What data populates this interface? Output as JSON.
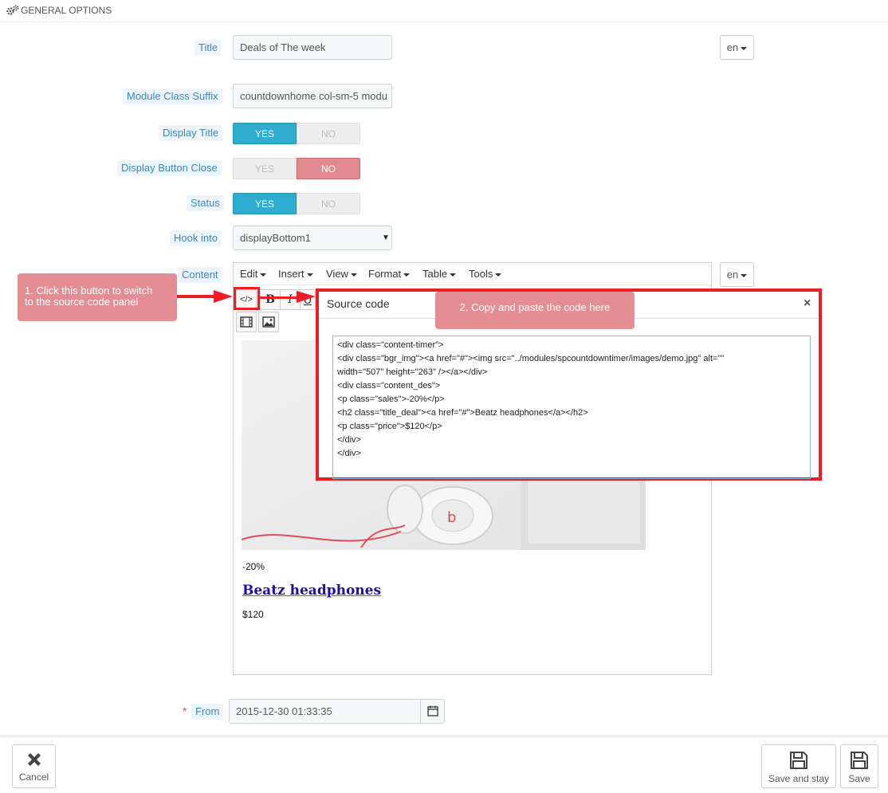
{
  "header": {
    "title": "GENERAL OPTIONS",
    "icon": "gears-icon"
  },
  "form": {
    "title_label": "Title",
    "title_value": "Deals of The week",
    "title_lang": "en",
    "suffix_label": "Module Class Suffix",
    "suffix_value": "countdownhome col-sm-5 modu",
    "display_title_label": "Display Title",
    "display_title_value": "YES",
    "display_close_label": "Display Button Close",
    "display_close_value": "NO",
    "status_label": "Status",
    "status_value": "YES",
    "yes": "YES",
    "no": "NO",
    "hook_label": "Hook into",
    "hook_value": "displayBottom1",
    "content_label": "Content",
    "content_lang": "en",
    "from_label": "From",
    "from_required": "*",
    "from_value": "2015-12-30 01:33:35"
  },
  "editor": {
    "menu": [
      "Edit",
      "Insert",
      "View",
      "Format",
      "Table",
      "Tools"
    ],
    "source_btn": "</>",
    "bold": "B",
    "italic": "I",
    "underline": "U",
    "preview": {
      "sales": "-20%",
      "title": "Beatz headphones",
      "price": "$120"
    }
  },
  "dialog": {
    "title": "Source code",
    "close": "×",
    "code": "<div class=\"content-timer\">\n<div class=\"bgr_img\"><a href=\"#\"><img src=\"../modules/spcountdowntimer/images/demo.jpg\" alt=\"\"\nwidth=\"507\" height=\"263\" /></a></div>\n<div class=\"content_des\">\n<p class=\"sales\">-20%</p>\n<h2 class=\"title_deal\"><a href=\"#\">Beatz headphones</a></h2>\n<p class=\"price\">$120</p>\n</div>\n</div>"
  },
  "callouts": {
    "step1_line1": "1. Click this button to switch",
    "step1_line2": "to the source code panel",
    "step2": "2. Copy and paste the code here"
  },
  "footer": {
    "cancel": "Cancel",
    "save_stay": "Save and stay",
    "save": "Save"
  },
  "colors": {
    "accent": "#2eacce",
    "no_active": "#e08a90",
    "highlight": "#ee1c24",
    "callout": "#e48d92"
  }
}
